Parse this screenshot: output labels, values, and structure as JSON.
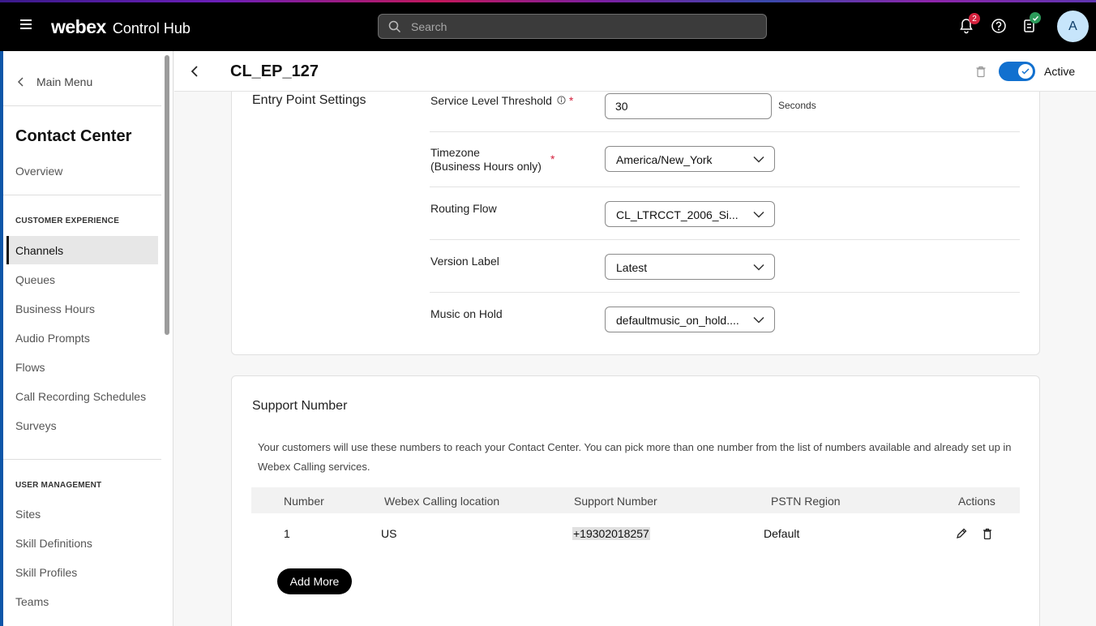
{
  "topbar": {
    "brand": "webex",
    "product": "Control Hub",
    "search_placeholder": "Search",
    "notification_count": "2",
    "avatar_initial": "A"
  },
  "sidebar": {
    "main_menu": "Main Menu",
    "title": "Contact Center",
    "overview": "Overview",
    "section1": "CUSTOMER EXPERIENCE",
    "items1": [
      "Channels",
      "Queues",
      "Business Hours",
      "Audio Prompts",
      "Flows",
      "Call Recording Schedules",
      "Surveys"
    ],
    "section2": "USER MANAGEMENT",
    "items2": [
      "Sites",
      "Skill Definitions",
      "Skill Profiles",
      "Teams"
    ]
  },
  "header": {
    "title": "CL_EP_127",
    "status": "Active"
  },
  "entry_point": {
    "title": "Entry Point Settings",
    "service_level_label": "Service Level Threshold",
    "service_level_value": "30",
    "service_level_unit": "Seconds",
    "timezone_label_1": "Timezone",
    "timezone_label_2": "(Business Hours only)",
    "timezone_value": "America/New_York",
    "routing_flow_label": "Routing Flow",
    "routing_flow_value": "CL_LTRCCT_2006_Si...",
    "version_label_label": "Version Label",
    "version_label_value": "Latest",
    "music_label": "Music on Hold",
    "music_value": "defaultmusic_on_hold...."
  },
  "support_number": {
    "title": "Support Number",
    "description": "Your customers will use these numbers to reach your Contact Center. You can pick more than one number from the list of numbers available and already set up in Webex Calling services.",
    "columns": [
      "Number",
      "Webex Calling location",
      "Support Number",
      "PSTN Region",
      "Actions"
    ],
    "rows": [
      {
        "number": "1",
        "location": "US",
        "support_number": "+19302018257",
        "region": "Default"
      }
    ],
    "add_more": "Add More"
  },
  "colors": {
    "accent": "#1170cf",
    "required": "#d4213d",
    "notification_badge": "#d4213d",
    "check_badge": "#2b9a5a"
  }
}
